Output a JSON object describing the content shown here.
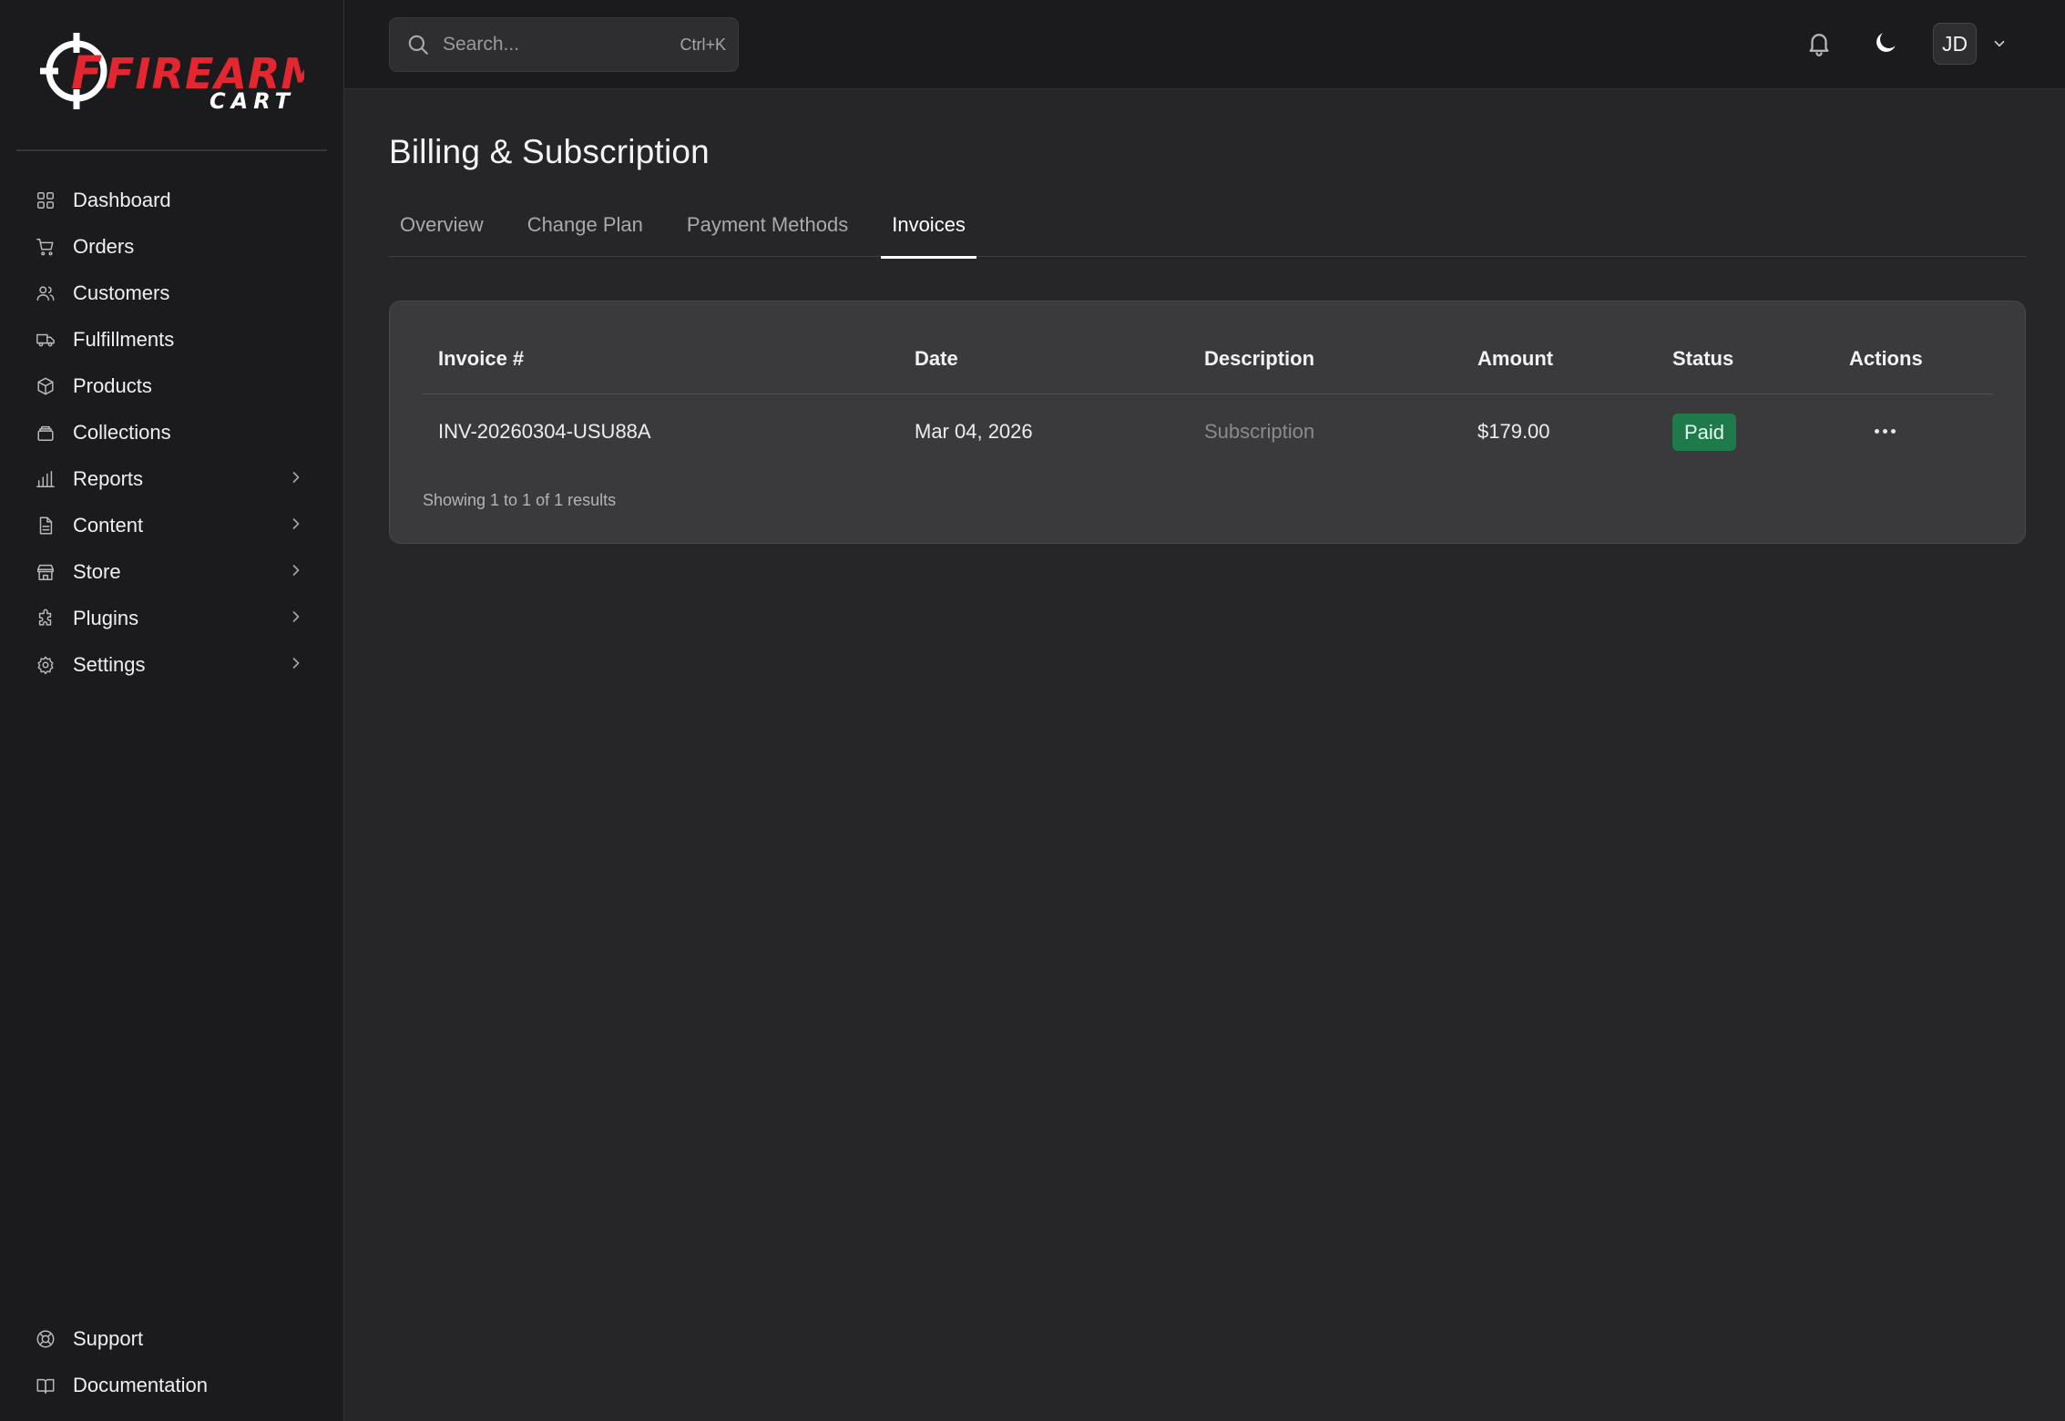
{
  "brand": {
    "name_top": "FIREARM",
    "name_bottom": "CART",
    "accent": "#e32630"
  },
  "sidebar": {
    "items": [
      {
        "label": "Dashboard",
        "icon": "grid-icon",
        "has_submenu": false
      },
      {
        "label": "Orders",
        "icon": "cart-icon",
        "has_submenu": false
      },
      {
        "label": "Customers",
        "icon": "users-icon",
        "has_submenu": false
      },
      {
        "label": "Fulfillments",
        "icon": "truck-icon",
        "has_submenu": false
      },
      {
        "label": "Products",
        "icon": "box-icon",
        "has_submenu": false
      },
      {
        "label": "Collections",
        "icon": "layers-icon",
        "has_submenu": false
      },
      {
        "label": "Reports",
        "icon": "bar-chart-icon",
        "has_submenu": true
      },
      {
        "label": "Content",
        "icon": "file-icon",
        "has_submenu": true
      },
      {
        "label": "Store",
        "icon": "store-icon",
        "has_submenu": true
      },
      {
        "label": "Plugins",
        "icon": "puzzle-icon",
        "has_submenu": true
      },
      {
        "label": "Settings",
        "icon": "gear-icon",
        "has_submenu": true
      }
    ],
    "bottom_items": [
      {
        "label": "Support",
        "icon": "lifebuoy-icon"
      },
      {
        "label": "Documentation",
        "icon": "book-icon"
      }
    ]
  },
  "topbar": {
    "search": {
      "placeholder": "Search...",
      "shortcut": "Ctrl+K"
    },
    "user_initials": "JD"
  },
  "page": {
    "title": "Billing & Subscription",
    "tabs": [
      {
        "label": "Overview",
        "active": false
      },
      {
        "label": "Change Plan",
        "active": false
      },
      {
        "label": "Payment Methods",
        "active": false
      },
      {
        "label": "Invoices",
        "active": true
      }
    ]
  },
  "invoices": {
    "columns": [
      "Invoice #",
      "Date",
      "Description",
      "Amount",
      "Status",
      "Actions"
    ],
    "rows": [
      {
        "invoice": "INV-20260304-USU88A",
        "date": "Mar 04, 2026",
        "description": "Subscription",
        "amount": "$179.00",
        "status": "Paid"
      }
    ],
    "summary": "Showing 1 to 1 of 1 results",
    "status_color": "#1e7a4a"
  }
}
